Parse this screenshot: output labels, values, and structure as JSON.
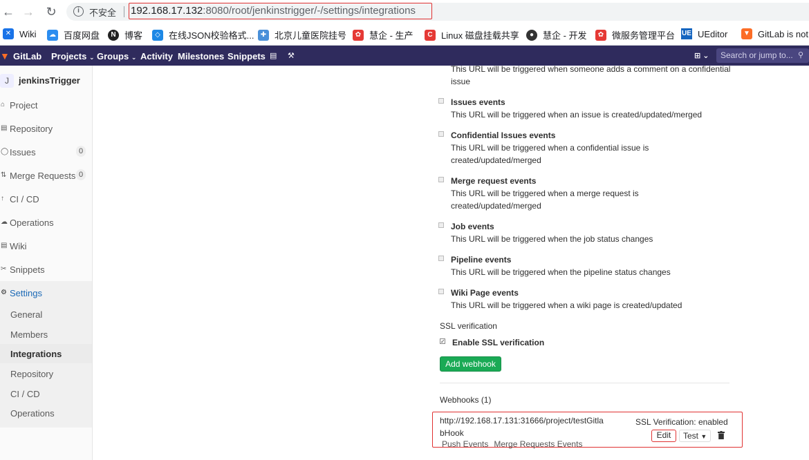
{
  "browser": {
    "insecure_label": "不安全",
    "url_host": "192.168.17.132",
    "url_rest": ":8080/root/jenkinstrigger/-/settings/integrations",
    "bookmarks": [
      {
        "label": "Wiki",
        "icon": "wiki-icon",
        "color": "#1a73e8"
      },
      {
        "label": "百度网盘",
        "icon": "baidu-pan-icon",
        "color": "#2b8df0"
      },
      {
        "label": "博客",
        "icon": "blog-icon",
        "color": "#222222"
      },
      {
        "label": "在线JSON校验格式...",
        "icon": "json-icon",
        "color": "#1e88e5"
      },
      {
        "label": "北京儿童医院挂号",
        "icon": "hospital-icon",
        "color": "#4a90d9"
      },
      {
        "label": "慧企 - 生产",
        "icon": "huiqi-icon",
        "color": "#e53935"
      },
      {
        "label": "Linux 磁盘挂载共享",
        "icon": "csdn-icon",
        "color": "#e53935"
      },
      {
        "label": "慧企 - 开发",
        "icon": "github-icon",
        "color": "#333333"
      },
      {
        "label": "微服务管理平台",
        "icon": "microservice-icon",
        "color": "#e53935"
      },
      {
        "label": "UEditor",
        "icon": "ueditor-icon",
        "color": "#1565c0"
      },
      {
        "label": "GitLab is not",
        "icon": "gitlab-icon",
        "color": "#fc6d26"
      }
    ]
  },
  "header": {
    "brand": "GitLab",
    "projects": "Projects",
    "groups": "Groups",
    "activity": "Activity",
    "milestones": "Milestones",
    "snippets": "Snippets",
    "search_placeholder": "Search or jump to..."
  },
  "sidebar": {
    "avatar_letter": "J",
    "project_name": "jenkinsTrigger",
    "items": [
      {
        "label": "Project",
        "icon": "home-icon"
      },
      {
        "label": "Repository",
        "icon": "repo-icon"
      },
      {
        "label": "Issues",
        "icon": "issues-icon",
        "count": "0"
      },
      {
        "label": "Merge Requests",
        "icon": "merge-icon",
        "count": "0"
      },
      {
        "label": "CI / CD",
        "icon": "rocket-icon"
      },
      {
        "label": "Operations",
        "icon": "cloud-icon"
      },
      {
        "label": "Wiki",
        "icon": "book-icon"
      },
      {
        "label": "Snippets",
        "icon": "scissors-icon"
      },
      {
        "label": "Settings",
        "icon": "gear-icon"
      }
    ],
    "sub_items": [
      "General",
      "Members",
      "Integrations",
      "Repository",
      "CI / CD",
      "Operations"
    ]
  },
  "main": {
    "top_partial": "This URL will be triggered when someone adds a comment on a confidential issue",
    "events": [
      {
        "title": "Issues events",
        "desc": "This URL will be triggered when an issue is created/updated/merged"
      },
      {
        "title": "Confidential Issues events",
        "desc": "This URL will be triggered when a confidential issue is created/updated/merged"
      },
      {
        "title": "Merge request events",
        "desc": "This URL will be triggered when a merge request is created/updated/merged"
      },
      {
        "title": "Job events",
        "desc": "This URL will be triggered when the job status changes"
      },
      {
        "title": "Pipeline events",
        "desc": "This URL will be triggered when the pipeline status changes"
      },
      {
        "title": "Wiki Page events",
        "desc": "This URL will be triggered when a wiki page is created/updated"
      }
    ],
    "ssl_heading": "SSL verification",
    "ssl_label": "Enable SSL verification",
    "add_webhook": "Add webhook",
    "webhooks_heading": "Webhooks (1)",
    "webhook": {
      "url": "http://192.168.17.131:31666/project/testGitlabHook",
      "events": [
        "Push Events",
        "Merge Requests Events"
      ],
      "ssl_status": "SSL Verification: enabled",
      "edit": "Edit",
      "test": "Test"
    }
  }
}
